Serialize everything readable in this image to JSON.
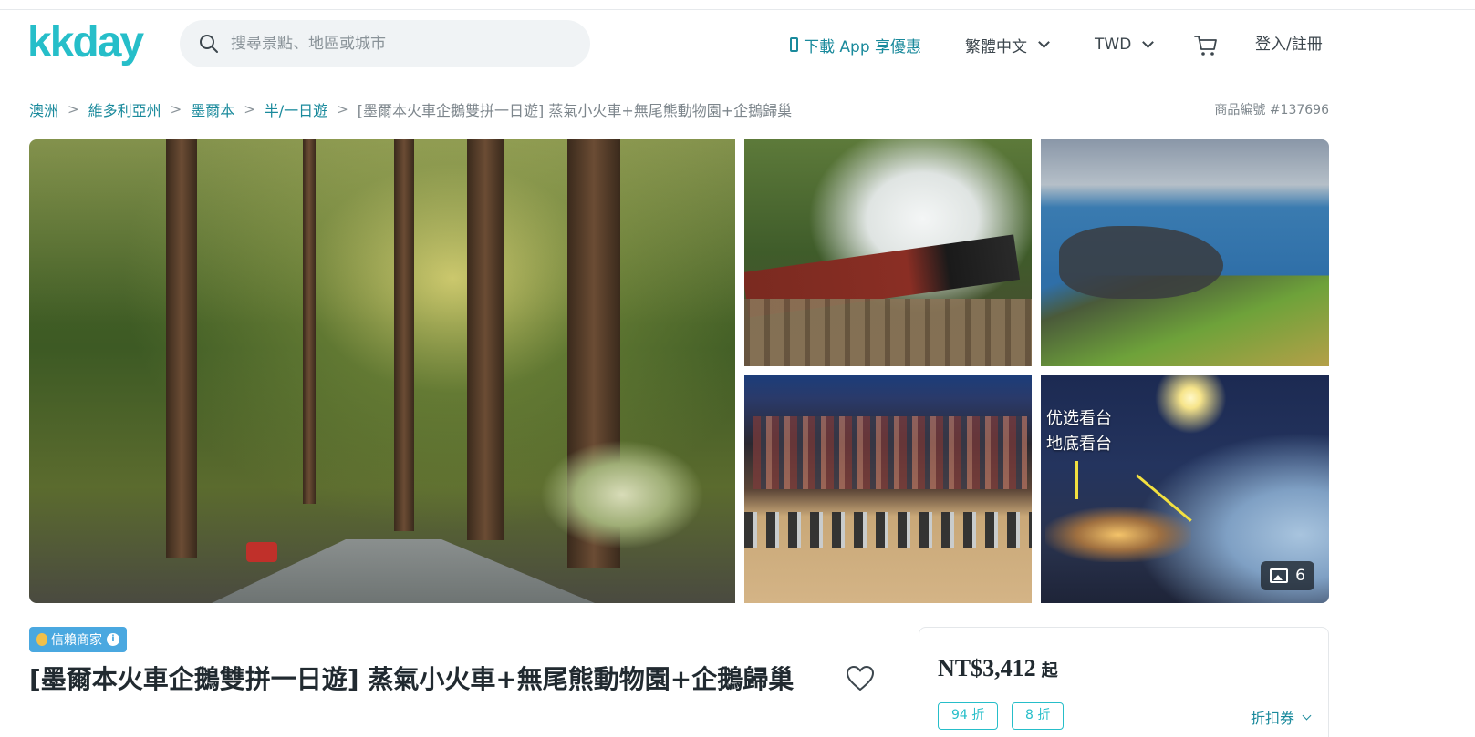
{
  "header": {
    "logo_text": "kkday",
    "search_placeholder": "搜尋景點、地區或城市",
    "app_promo": "下載 App 享優惠",
    "language": "繁體中文",
    "currency": "TWD",
    "login": "登入/註冊"
  },
  "breadcrumb": {
    "items": [
      "澳洲",
      "維多利亞州",
      "墨爾本",
      "半/一日遊"
    ],
    "current": "[墨爾本火車企鵝雙拼一日遊] 蒸氣小火車+無尾熊動物園+企鵝歸巢",
    "separator": ">"
  },
  "product_id": "商品編號 #137696",
  "gallery": {
    "overlay_line1": "优选看台",
    "overlay_line2": "地底看台",
    "photo_count": "6"
  },
  "product": {
    "badge": "信賴商家",
    "badge_info": "i",
    "title": "[墨爾本火車企鵝雙拼一日遊] 蒸氣小火車+無尾熊動物園+企鵝歸巢"
  },
  "price_card": {
    "price": "NT$3,412",
    "price_suffix": "起",
    "coupons": [
      "94 折",
      "8 折"
    ],
    "discount_link": "折扣券"
  },
  "colors": {
    "brand": "#26bec9",
    "link": "#1a8a9c",
    "badge": "#4aa8e0"
  }
}
